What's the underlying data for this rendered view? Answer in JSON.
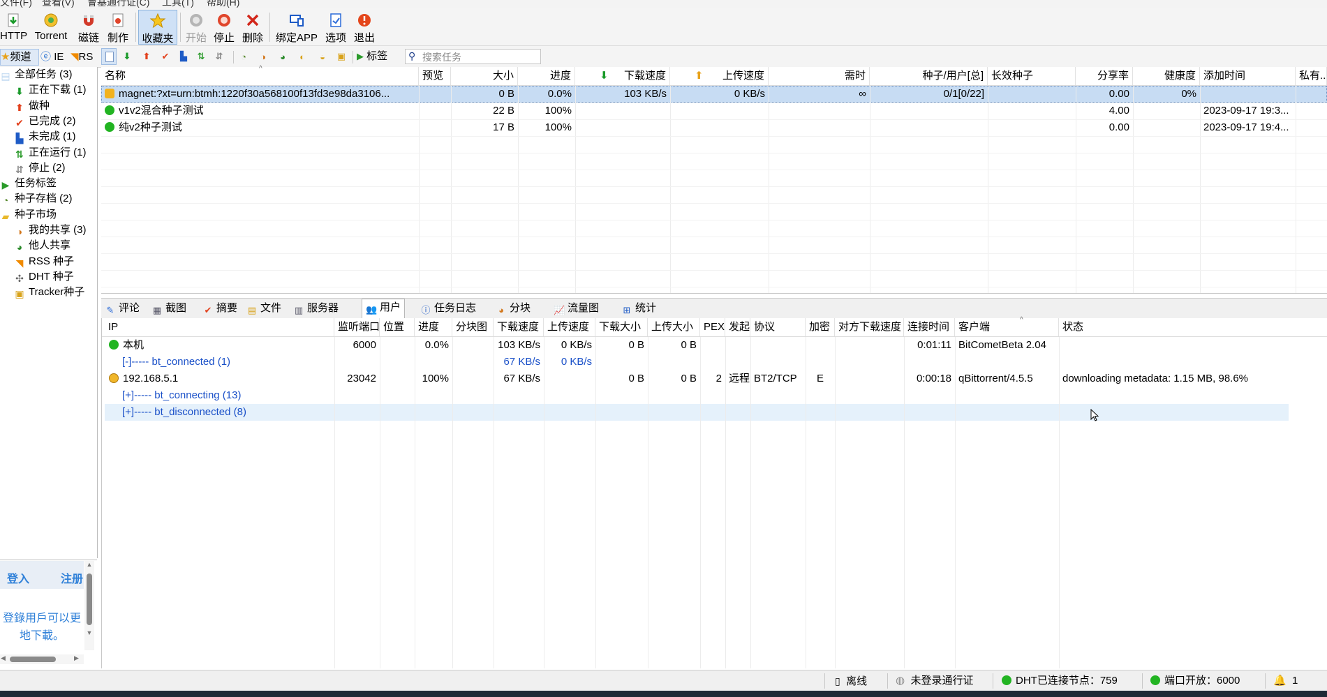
{
  "menu": [
    "文件(F)",
    "查看(V)",
    "會基通行证(C)",
    "工具(T)",
    "帮助(H)"
  ],
  "toolbar": [
    {
      "label": "HTTP",
      "icon": "http-download-icon"
    },
    {
      "label": "Torrent",
      "icon": "torrent-icon"
    },
    {
      "label": "磁链",
      "icon": "magnet-icon"
    },
    {
      "label": "制作",
      "icon": "make-torrent-icon"
    },
    {
      "label": "收藏夹",
      "icon": "favorites-star-icon"
    },
    {
      "label": "开始",
      "icon": "start-icon"
    },
    {
      "label": "停止",
      "icon": "stop-icon"
    },
    {
      "label": "删除",
      "icon": "delete-icon"
    },
    {
      "label": "绑定APP",
      "icon": "bind-app-icon"
    },
    {
      "label": "选项",
      "icon": "options-icon"
    },
    {
      "label": "退出",
      "icon": "exit-icon"
    }
  ],
  "toolbar2": {
    "tag_label": "标签",
    "search_placeholder": "搜索任务"
  },
  "left_tabs": [
    "频道",
    "IE",
    "RS"
  ],
  "tree": [
    {
      "label": "全部任务 (3)",
      "level": 0,
      "icon": "all-tasks-icon"
    },
    {
      "label": "正在下载 (1)",
      "level": 1,
      "icon": "downloading-icon"
    },
    {
      "label": "做种",
      "level": 1,
      "icon": "seeding-icon"
    },
    {
      "label": "已完成 (2)",
      "level": 1,
      "icon": "completed-icon"
    },
    {
      "label": "未完成 (1)",
      "level": 1,
      "icon": "incomplete-icon"
    },
    {
      "label": "正在运行 (1)",
      "level": 1,
      "icon": "running-icon"
    },
    {
      "label": "停止 (2)",
      "level": 1,
      "icon": "stopped-icon"
    },
    {
      "label": "任务标签",
      "level": 0,
      "icon": "task-tag-icon"
    },
    {
      "label": "种子存档 (2)",
      "level": 0,
      "icon": "torrent-archive-icon"
    },
    {
      "label": "种子市场",
      "level": 0,
      "icon": "torrent-market-icon"
    },
    {
      "label": "我的共享 (3)",
      "level": 1,
      "icon": "my-share-icon"
    },
    {
      "label": "他人共享",
      "level": 1,
      "icon": "others-share-icon"
    },
    {
      "label": "RSS 种子",
      "level": 1,
      "icon": "rss-icon"
    },
    {
      "label": "DHT 种子",
      "level": 1,
      "icon": "dht-icon"
    },
    {
      "label": "Tracker种子",
      "level": 1,
      "icon": "tracker-icon"
    }
  ],
  "login": {
    "login": "登入",
    "register": "注册",
    "promo": "登錄用戶可以更",
    "promo2": "地下載。"
  },
  "task_columns": [
    "名称",
    "预览",
    "大小",
    "进度",
    "下载速度",
    "上传速度",
    "需时",
    "种子/用户[总]",
    "长效种子",
    "分享率",
    "健康度",
    "添加时间",
    "私有..."
  ],
  "tasks": [
    {
      "name": "magnet:?xt=urn:btmh:1220f30a568100f13fd3e98da3106...",
      "size": "0 B",
      "progress": "0.0%",
      "down": "103 KB/s",
      "up": "0 KB/s",
      "eta": "∞",
      "peers": "0/1[0/22]",
      "ratio": "0.00",
      "health": "0%",
      "added": "",
      "status": "downloading-magnet"
    },
    {
      "name": "v1v2混合种子测试",
      "size": "22 B",
      "progress": "100%",
      "down": "",
      "up": "",
      "eta": "",
      "peers": "",
      "ratio": "4.00",
      "health": "",
      "added": "2023-09-17 19:3...",
      "status": "done"
    },
    {
      "name": "纯v2种子测试",
      "size": "17 B",
      "progress": "100%",
      "down": "",
      "up": "",
      "eta": "",
      "peers": "",
      "ratio": "0.00",
      "health": "",
      "added": "2023-09-17 19:4...",
      "status": "done"
    }
  ],
  "tabs": [
    {
      "label": "评论",
      "icon": "comment-icon"
    },
    {
      "label": "截图",
      "icon": "screenshot-icon"
    },
    {
      "label": "摘要",
      "icon": "summary-icon"
    },
    {
      "label": "文件",
      "icon": "files-icon"
    },
    {
      "label": "服务器",
      "icon": "server-icon"
    },
    {
      "label": "用户",
      "icon": "users-icon"
    },
    {
      "label": "任务日志",
      "icon": "task-log-icon"
    },
    {
      "label": "分块",
      "icon": "pieces-icon"
    },
    {
      "label": "流量图",
      "icon": "traffic-chart-icon"
    },
    {
      "label": "统计",
      "icon": "stats-icon"
    }
  ],
  "peer_columns": [
    "IP",
    "监听端口",
    "位置",
    "进度",
    "分块图",
    "下载速度",
    "上传速度",
    "下载大小",
    "上传大小",
    "PEX",
    "发起",
    "协议",
    "加密",
    "对方下载速度",
    "连接时间",
    "客户端",
    "状态"
  ],
  "peers": [
    {
      "ip": "本机",
      "port": "6000",
      "progress": "0.0%",
      "down": "103 KB/s",
      "up": "0 KB/s",
      "dsize": "0 B",
      "usize": "0 B",
      "pex": "",
      "init": "",
      "proto": "",
      "enc": "",
      "rdown": "",
      "time": "0:01:11",
      "client": "BitCometBeta 2.04",
      "state": "",
      "kind": "local"
    },
    {
      "ip": "[-]----- bt_connected (1)",
      "port": "",
      "progress": "",
      "down": "67 KB/s",
      "up": "0 KB/s",
      "dsize": "",
      "usize": "",
      "pex": "",
      "init": "",
      "proto": "",
      "enc": "",
      "rdown": "",
      "time": "",
      "client": "",
      "state": "",
      "kind": "group"
    },
    {
      "ip": "192.168.5.1",
      "port": "23042",
      "progress": "100%",
      "down": "67 KB/s",
      "up": "",
      "dsize": "0 B",
      "usize": "0 B",
      "pex": "2",
      "init": "远程",
      "proto": "BT2/TCP",
      "enc": "E",
      "rdown": "",
      "time": "0:00:18",
      "client": "qBittorrent/4.5.5",
      "state": "downloading metadata: 1.15 MB, 98.6%",
      "kind": "peer"
    },
    {
      "ip": "[+]----- bt_connecting (13)",
      "port": "",
      "progress": "",
      "down": "",
      "up": "",
      "dsize": "",
      "usize": "",
      "pex": "",
      "init": "",
      "proto": "",
      "enc": "",
      "rdown": "",
      "time": "",
      "client": "",
      "state": "",
      "kind": "group"
    },
    {
      "ip": "[+]----- bt_disconnected (8)",
      "port": "",
      "progress": "",
      "down": "",
      "up": "",
      "dsize": "",
      "usize": "",
      "pex": "",
      "init": "",
      "proto": "",
      "enc": "",
      "rdown": "",
      "time": "",
      "client": "",
      "state": "",
      "kind": "group-selected"
    }
  ],
  "status": {
    "offline": "离线",
    "passport": "未登录通行证",
    "dht": "DHT已连接节点：759",
    "port": "端口开放：6000",
    "alerts": "1"
  },
  "colors": {
    "selected_row": "#c7dcf3",
    "hover_row": "#e5f1fb",
    "green": "#22b422",
    "link_blue": "#1a50c8"
  }
}
